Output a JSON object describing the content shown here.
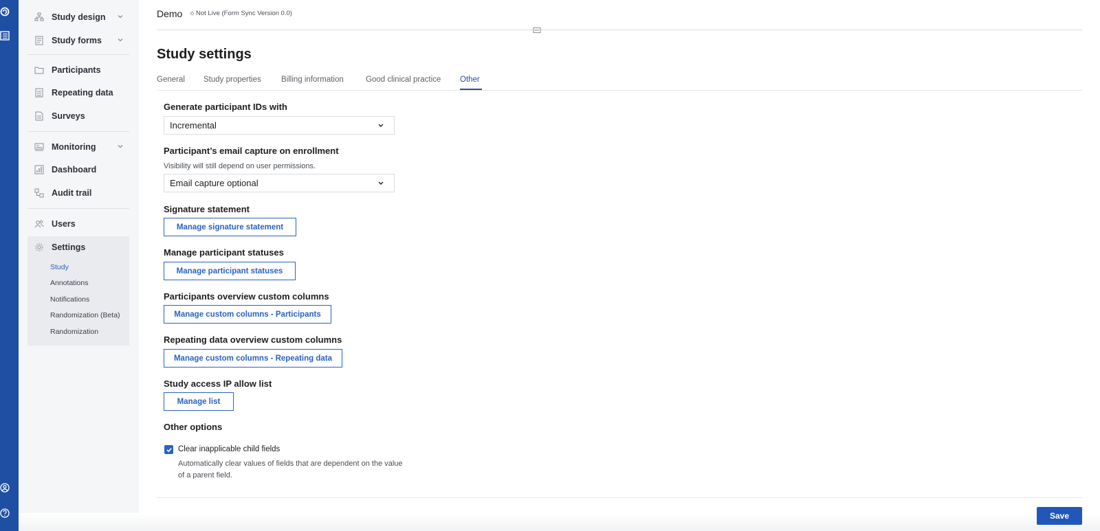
{
  "colors": {
    "rail": "#1f4fa3",
    "accent": "#2b62c4",
    "save": "#2157b8",
    "sidebar_bg": "#f5f6f8"
  },
  "rail": {
    "icons": [
      "app-logo-icon",
      "forms-icon",
      "user-account-icon",
      "help-icon"
    ]
  },
  "sidebar": {
    "study_design": "Study design",
    "study_forms": "Study forms",
    "participants": "Participants",
    "repeating_data": "Repeating data",
    "surveys": "Surveys",
    "monitoring": "Monitoring",
    "dashboard": "Dashboard",
    "audit_trail": "Audit trail",
    "users": "Users",
    "settings": "Settings",
    "settings_sub": [
      "Study",
      "Annotations",
      "Notifications",
      "Randomization (Beta)",
      "Randomization"
    ]
  },
  "header": {
    "title": "Demo",
    "status": "Not Live (Form Sync Version 0.0)"
  },
  "page": {
    "title": "Study settings"
  },
  "tabs": [
    "General",
    "Study properties",
    "Billing information",
    "Good clinical practice",
    "Other"
  ],
  "form": {
    "participant_ids": {
      "label": "Generate participant IDs with",
      "value": "Incremental"
    },
    "email_capture": {
      "label": "Participant’s email capture on enrollment",
      "help": "Visibility will still depend on user permissions.",
      "value": "Email capture optional"
    },
    "signature": {
      "label": "Signature statement",
      "button": "Manage signature statement"
    },
    "statuses": {
      "label": "Manage participant statuses",
      "button": "Manage participant statuses"
    },
    "participants_columns": {
      "label": "Participants overview custom columns",
      "button": "Manage custom columns - Participants"
    },
    "repeating_columns": {
      "label": "Repeating data overview custom columns",
      "button": "Manage custom columns - Repeating data"
    },
    "ip_allow": {
      "label": "Study access IP allow list",
      "button": "Manage list"
    },
    "other_options": {
      "label": "Other options",
      "clear_child": {
        "label": "Clear inapplicable child fields",
        "description": "Automatically clear values of fields that are dependent on the value of a parent field.",
        "checked": true
      }
    }
  },
  "footer": {
    "save": "Save"
  }
}
